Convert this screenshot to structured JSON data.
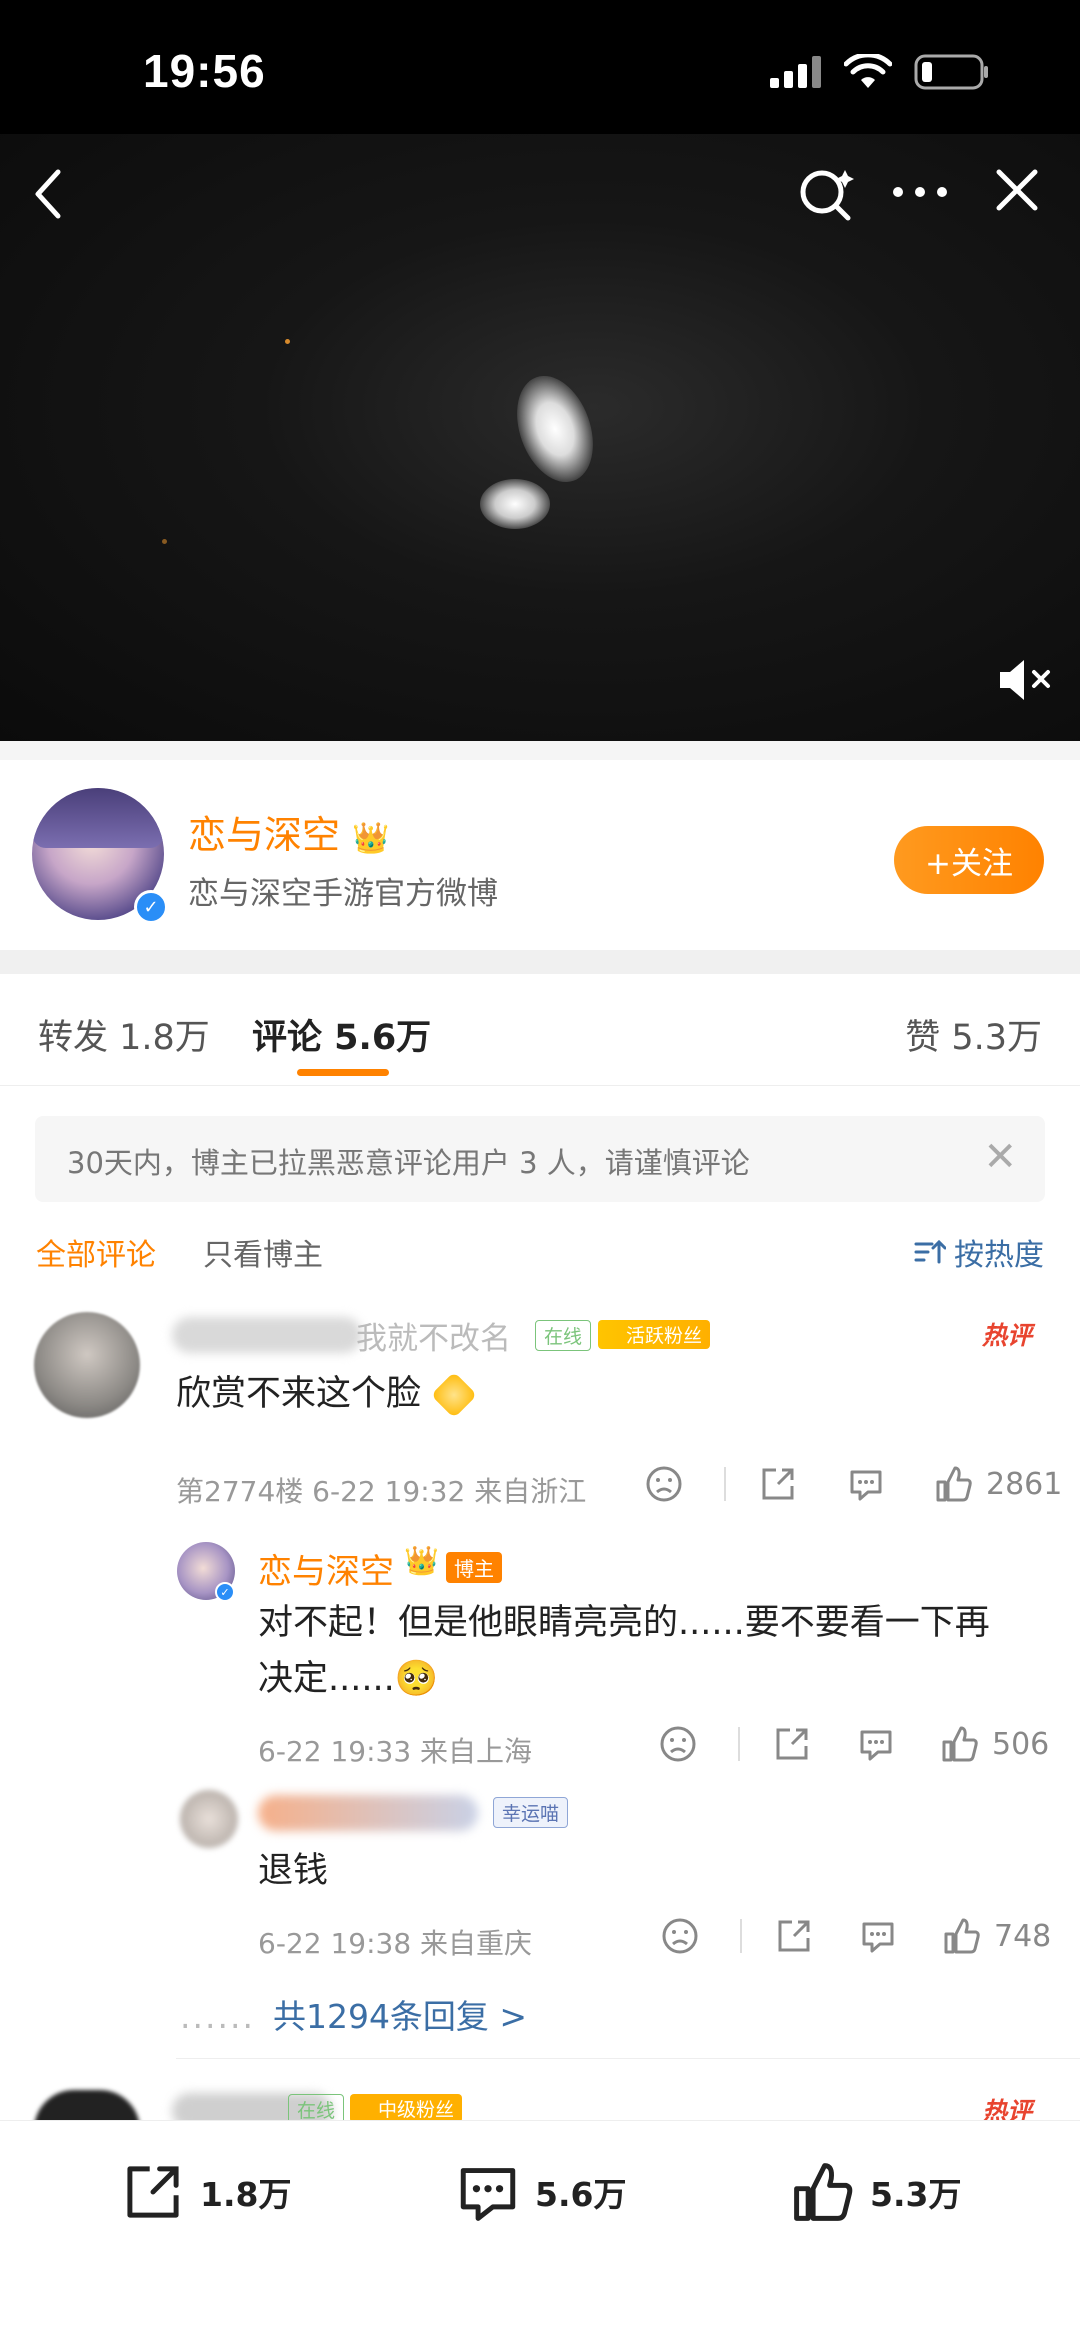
{
  "status_bar": {
    "time": "19:56"
  },
  "video": {
    "controls": [
      "back-icon",
      "search-icon",
      "more-icon",
      "close-icon"
    ],
    "mute_icon": "mute-icon"
  },
  "profile": {
    "name": "恋与深空",
    "subtitle": "恋与深空手游官方微博",
    "follow_label": "+关注"
  },
  "tabs": {
    "repost": "转发 1.8万",
    "comments": "评论 5.6万",
    "likes": "赞 5.3万"
  },
  "notice": {
    "text": "30天内，博主已拉黑恶意评论用户 3 人，请谨慎评论"
  },
  "filter": {
    "all": "全部评论",
    "author_only": "只看博主",
    "sort": "按热度"
  },
  "comments": [
    {
      "name_visible": "我就不改名",
      "badges": [
        "在线",
        "活跃粉丝"
      ],
      "hot_tag": "热评",
      "text": "欣赏不来这个脸",
      "meta": "第2774楼 6-22 19:32 来自浙江",
      "likes": "2861",
      "replies": [
        {
          "name": "恋与深空",
          "badge": "博主",
          "text_line1": "对不起！但是他眼睛亮亮的......要不要看一下再",
          "text_line2": "决定......🥺",
          "meta": "6-22 19:33 来自上海",
          "likes": "506"
        },
        {
          "badge": "幸运喵",
          "text": "退钱",
          "meta": "6-22 19:38 来自重庆",
          "likes": "748"
        }
      ],
      "more_replies": "共1294条回复 >"
    },
    {
      "badges": [
        "在线",
        "中级粉丝"
      ],
      "hot_tag": "热评"
    }
  ],
  "bottom_bar": {
    "repost": "1.8万",
    "comment": "5.6万",
    "like": "5.3万"
  },
  "colors": {
    "accent": "#ff8200",
    "link": "#3b6ea5",
    "hot": "#e8442f"
  }
}
